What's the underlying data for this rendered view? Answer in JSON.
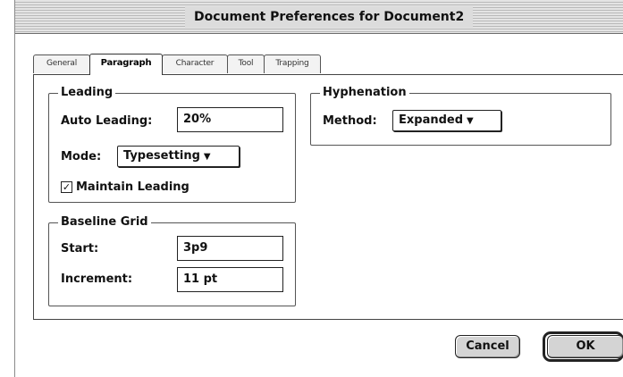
{
  "window": {
    "title": "Document Preferences for Document2"
  },
  "tabs": [
    {
      "label": "General",
      "active": false
    },
    {
      "label": "Paragraph",
      "active": true
    },
    {
      "label": "Character",
      "active": false
    },
    {
      "label": "Tool",
      "active": false
    },
    {
      "label": "Trapping",
      "active": false
    }
  ],
  "leading": {
    "legend": "Leading",
    "auto_leading_label": "Auto Leading:",
    "auto_leading_value": "20%",
    "mode_label": "Mode:",
    "mode_value": "Typesetting",
    "maintain_leading_label": "Maintain Leading",
    "maintain_leading_checked": true
  },
  "baseline_grid": {
    "legend": "Baseline Grid",
    "start_label": "Start:",
    "start_value": "3p9",
    "increment_label": "Increment:",
    "increment_value": "11 pt"
  },
  "hyphenation": {
    "legend": "Hyphenation",
    "method_label": "Method:",
    "method_value": "Expanded"
  },
  "buttons": {
    "cancel": "Cancel",
    "ok": "OK"
  },
  "icons": {
    "popup_arrow": "▼",
    "checkmark": "✓"
  }
}
